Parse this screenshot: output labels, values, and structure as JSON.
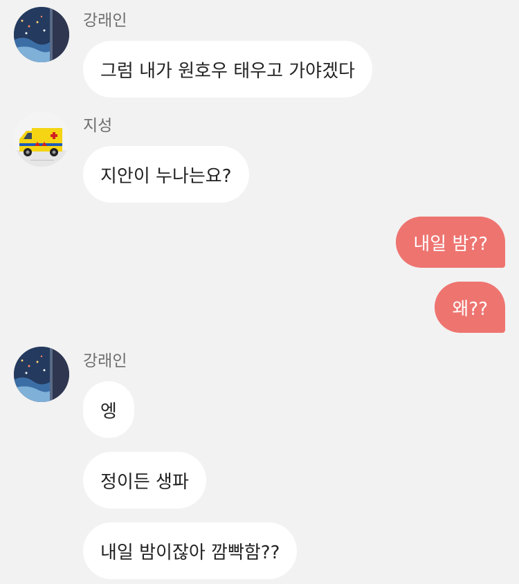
{
  "colors": {
    "background": "#f2f2f2",
    "incoming_bubble": "#ffffff",
    "outgoing_bubble": "#ee7470",
    "sender_name": "#6e6e6e",
    "incoming_text": "#222222",
    "outgoing_text": "#ffffff"
  },
  "groups": [
    {
      "sender": "강래인",
      "avatar_icon": "night-scene-avatar-icon",
      "messages": [
        "그럼 내가 원호우 태우고 가야겠다"
      ]
    },
    {
      "sender": "지성",
      "avatar_icon": "ambulance-avatar-icon",
      "messages": [
        "지안이 누나는요?"
      ]
    },
    {
      "sender": "me",
      "outgoing": true,
      "messages": [
        "내일 밤??",
        "왜??"
      ]
    },
    {
      "sender": "강래인",
      "avatar_icon": "night-scene-avatar-icon",
      "messages": [
        "엥",
        "정이든 생파",
        "내일 밤이잖아 깜빡함??"
      ]
    }
  ]
}
